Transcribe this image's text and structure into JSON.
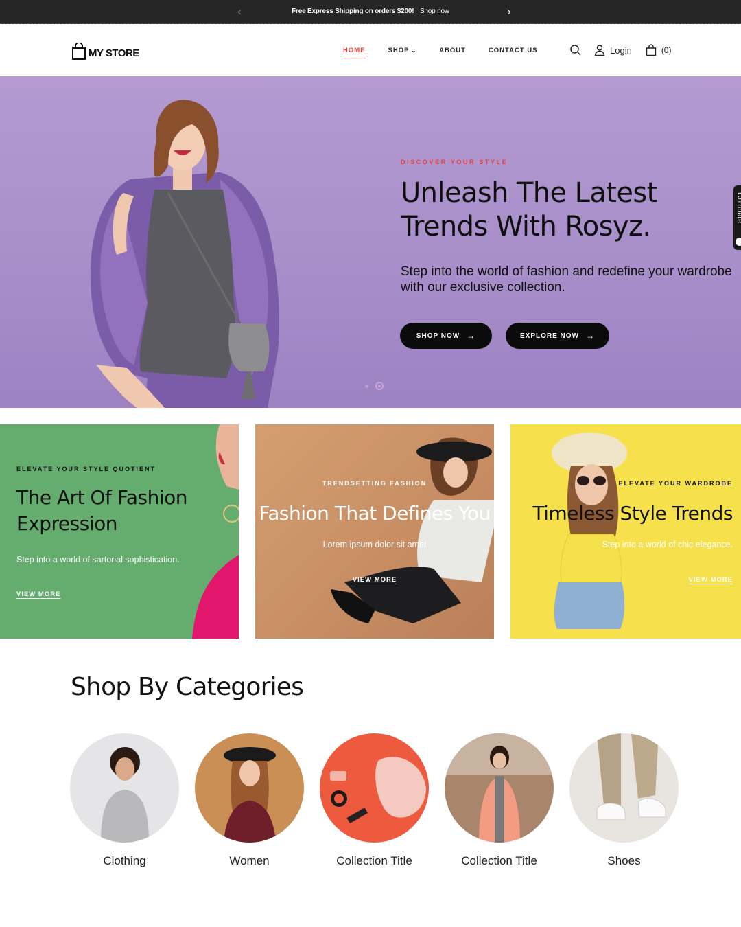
{
  "announcement": {
    "message": "Free Express Shipping on orders $200!",
    "link": "Shop now",
    "prev_icon": "chevron-left-icon",
    "next_icon": "chevron-right-icon"
  },
  "header": {
    "logo_text": "MY STORE",
    "nav": [
      {
        "label": "HOME",
        "active": true
      },
      {
        "label": "SHOP",
        "has_dropdown": true
      },
      {
        "label": "ABOUT"
      },
      {
        "label": "CONTACT US"
      }
    ],
    "login_label": "Login",
    "cart_count": "(0)"
  },
  "hero": {
    "kicker": "DISCOVER YOUR STYLE",
    "title": "Unleash The Latest Trends With Rosyz.",
    "subtitle": "Step into the world of fashion and redefine your wardrobe with our exclusive collection.",
    "primary_button": "SHOP NOW",
    "secondary_button": "EXPLORE NOW",
    "slide_count": 2,
    "active_slide": 2,
    "side_tab": "Compare",
    "accent_color": "#e8413c",
    "background_color": "#ad93cc"
  },
  "promos": [
    {
      "kicker": "ELEVATE YOUR STYLE QUOTIENT",
      "title": "The Art Of Fashion Expression",
      "subtitle": "Step into a world of sartorial sophistication.",
      "link": "VIEW MORE",
      "bg": "#64ad6e"
    },
    {
      "kicker": "TRENDSETTING FASHION",
      "title": "Fashion That Defines You",
      "subtitle": "Lorem ipsum dolor sit amet",
      "link": "VIEW MORE",
      "bg": "#c99066"
    },
    {
      "kicker": "ELEVATE YOUR WARDROBE",
      "title": "Timeless Style Trends",
      "subtitle": "Step into a world of chic elegance.",
      "link": "VIEW MORE",
      "bg": "#f6e04c"
    }
  ],
  "categories": {
    "title": "Shop By Categories",
    "items": [
      {
        "label": "Clothing"
      },
      {
        "label": "Women"
      },
      {
        "label": "Collection Title"
      },
      {
        "label": "Collection Title"
      },
      {
        "label": "Shoes"
      }
    ]
  }
}
